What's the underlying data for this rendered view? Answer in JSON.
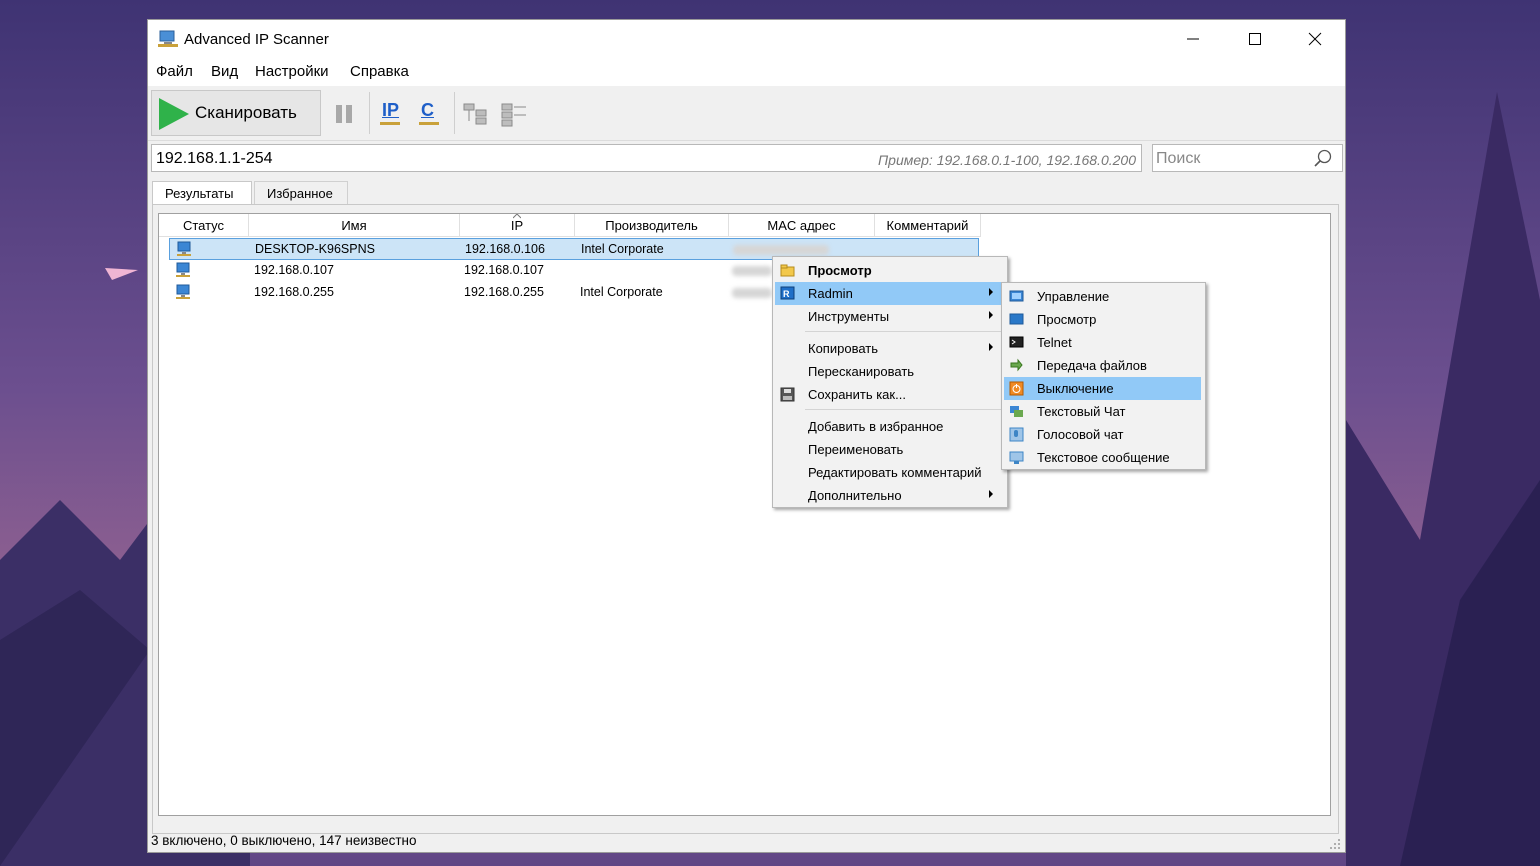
{
  "window": {
    "title": "Advanced IP Scanner",
    "controls": {
      "minimize": "—",
      "maximize": "☐",
      "close": "✕"
    }
  },
  "menu": [
    "Файл",
    "Вид",
    "Настройки",
    "Справка"
  ],
  "toolbar": {
    "scan_label": "Сканировать",
    "ip_label": "IP",
    "c_label": "C"
  },
  "address": {
    "value": "192.168.1.1-254",
    "hint": "Пример: 192.168.0.1-100, 192.168.0.200"
  },
  "search": {
    "placeholder": "Поиск"
  },
  "tabs": [
    "Результаты",
    "Избранное"
  ],
  "columns": [
    "Статус",
    "Имя",
    "IP",
    "Производитель",
    "MAC адрес",
    "Комментарий"
  ],
  "rows": [
    {
      "name": "DESKTOP-K96SPNS",
      "ip": "192.168.0.106",
      "vendor": "Intel Corporate",
      "selected": true
    },
    {
      "name": "192.168.0.107",
      "ip": "192.168.0.107",
      "vendor": "",
      "selected": false
    },
    {
      "name": "192.168.0.255",
      "ip": "192.168.0.255",
      "vendor": "Intel Corporate",
      "selected": false
    }
  ],
  "status": "3 включено, 0 выключено, 147 неизвестно",
  "context_menu": {
    "items": [
      {
        "label": "Просмотр",
        "bold": true,
        "icon": "folder-icon"
      },
      {
        "label": "Radmin",
        "submenu": true,
        "highlighted": true,
        "icon": "radmin-icon"
      },
      {
        "label": "Инструменты",
        "submenu": true
      },
      {
        "label": "Копировать",
        "submenu": true
      },
      {
        "label": "Пересканировать"
      },
      {
        "label": "Сохранить как...",
        "icon": "save-icon"
      },
      {
        "label": "Добавить в избранное"
      },
      {
        "label": "Переименовать"
      },
      {
        "label": "Редактировать комментарий"
      },
      {
        "label": "Дополнительно",
        "submenu": true
      }
    ]
  },
  "radmin_submenu": {
    "items": [
      {
        "label": "Управление",
        "icon": "control-icon"
      },
      {
        "label": "Просмотр",
        "icon": "view-icon"
      },
      {
        "label": "Telnet",
        "icon": "telnet-icon"
      },
      {
        "label": "Передача файлов",
        "icon": "file-transfer-icon"
      },
      {
        "label": "Выключение",
        "icon": "shutdown-icon",
        "highlighted": true
      },
      {
        "label": "Текстовый Чат",
        "icon": "text-chat-icon"
      },
      {
        "label": "Голосовой чат",
        "icon": "voice-chat-icon"
      },
      {
        "label": "Текстовое сообщение",
        "icon": "text-message-icon"
      }
    ]
  },
  "colors": {
    "accent": "#2fb24a",
    "selection": "#cce4f7",
    "menu_highlight": "#91c9f7"
  }
}
